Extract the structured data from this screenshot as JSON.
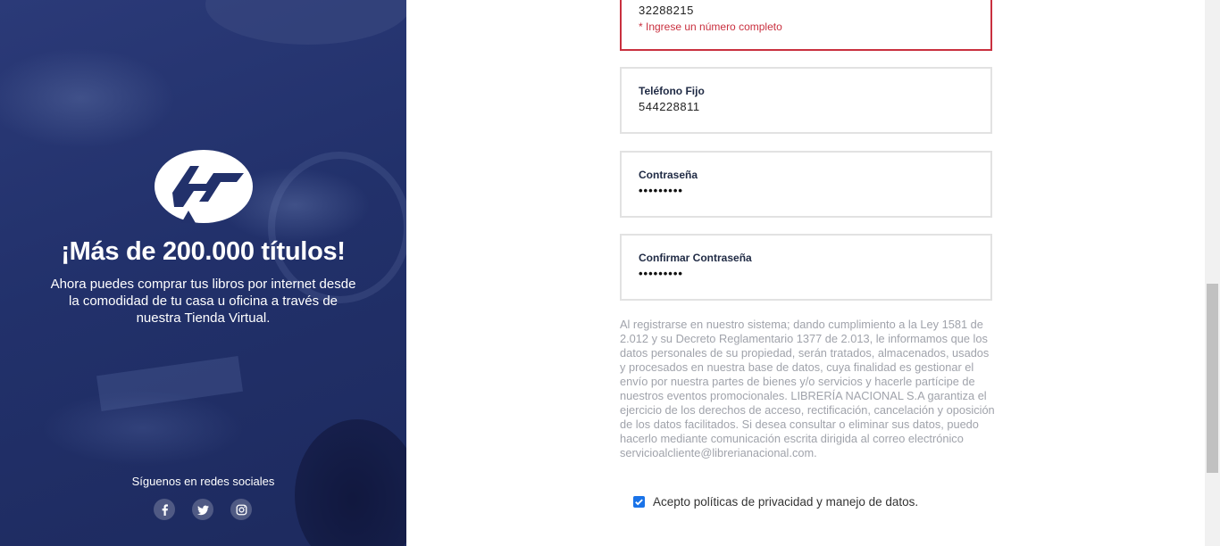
{
  "promo": {
    "headline": "¡Más de 200.000 títulos!",
    "subtext": "Ahora puedes comprar tus libros por internet desde la comodidad de tu casa u oficina a través de nuestra Tienda Virtual.",
    "social_label": "Síguenos en redes sociales",
    "social_icons": [
      "facebook-icon",
      "twitter-icon",
      "instagram-icon"
    ]
  },
  "form": {
    "mobile": {
      "value": "32288215",
      "error": "* Ingrese un número completo"
    },
    "landline": {
      "label": "Teléfono Fijo",
      "value": "544228811"
    },
    "password": {
      "label": "Contraseña",
      "value": "•••••••••"
    },
    "confirm_password": {
      "label": "Confirmar Contraseña",
      "value": "•••••••••"
    },
    "legal_text": "Al registrarse en nuestro sistema; dando cumplimiento a la Ley 1581 de 2.012 y su Decreto Reglamentario 1377 de 2.013, le informamos que los datos personales de su propiedad, serán tratados, almacenados, usados y procesados en nuestra base de datos, cuya finalidad es gestionar el envío por nuestra partes de bienes y/o servicios y hacerle partícipe de nuestros eventos promocionales. LIBRERÍA NACIONAL S.A garantiza el ejercicio de los derechos de acceso, rectificación, cancelación y oposición de los datos facilitados. Si desea consultar o eliminar sus datos, puedo hacerlo mediante comunicación escrita dirigida al correo electrónico servicioalcliente@librerianacional.com.",
    "consent_label": "Acepto políticas de privacidad y manejo de datos.",
    "consent_checked": true
  },
  "colors": {
    "panel": "#22316b",
    "error": "#c9303f",
    "checkbox": "#1a73e8"
  }
}
